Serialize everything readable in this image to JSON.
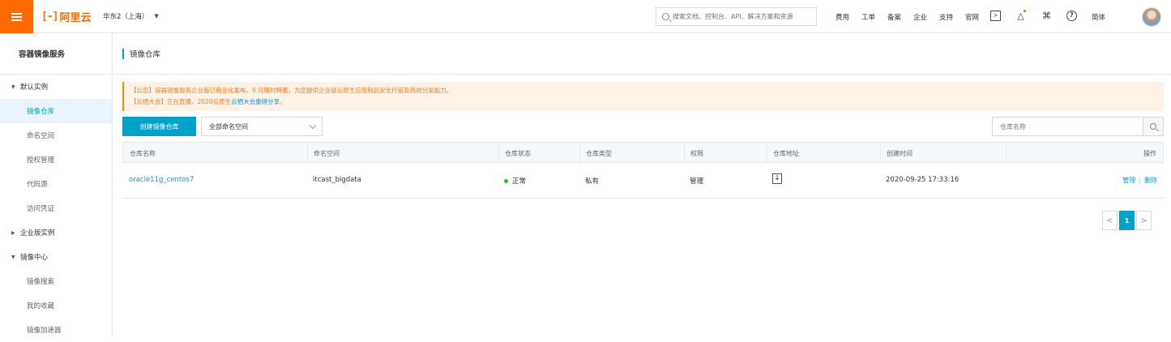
{
  "topbar": {
    "logo_mark": "[-]",
    "logo_text": "阿里云",
    "region": "华东2（上海）",
    "region_caret": "▼",
    "search_placeholder": "搜索文档、控制台、API、解决方案和资源",
    "links": [
      "费用",
      "工单",
      "备案",
      "企业",
      "支持",
      "官网"
    ],
    "lang": "简体"
  },
  "sidebar": {
    "title": "容器镜像服务",
    "groups": [
      {
        "label": "默认实例",
        "expanded": true,
        "items": [
          "镜像仓库",
          "命名空间",
          "授权管理",
          "代码源",
          "访问凭证"
        ]
      },
      {
        "label": "企业版实例",
        "expanded": false,
        "items": []
      },
      {
        "label": "镜像中心",
        "expanded": true,
        "items": [
          "镜像搜索",
          "我的收藏",
          "镜像加速器"
        ]
      }
    ],
    "active_item": "镜像仓库"
  },
  "page": {
    "title": "镜像仓库"
  },
  "notice": {
    "line1_prefix": "【公告】容器镜像服务企业版已",
    "line1_highlight1": "商业化发布",
    "line1_mid": "，9 月",
    "line1_highlight2": "限时特惠",
    "line1_suffix": "，为您提供企业级云原生应用制品安全托管及高效分发能力。",
    "line2_prefix": "【云栖大会】正在直播，2020云原生",
    "line2_link": "云栖大会重磅分享",
    "line2_suffix": "。"
  },
  "toolbar": {
    "create_button": "创建镜像仓库",
    "namespace_select": "全部命名空间",
    "repo_search_placeholder": "仓库名称"
  },
  "table": {
    "headers": [
      "仓库名称",
      "命名空间",
      "仓库状态",
      "仓库类型",
      "权限",
      "仓库地址",
      "创建时间",
      "操作"
    ],
    "rows": [
      {
        "name": "oracle11g_centos7",
        "namespace": "itcast_bigdata",
        "status": "正常",
        "type": "私有",
        "permission": "管理",
        "created": "2020-09-25 17:33:16",
        "op_manage": "管理",
        "op_delete": "删除"
      }
    ]
  },
  "pagination": {
    "prev": "<",
    "current": "1",
    "next": ">"
  },
  "colors": {
    "brand_orange": "#ff6a00",
    "accent_blue": "#00a2ca",
    "status_green": "#1dc11d"
  }
}
